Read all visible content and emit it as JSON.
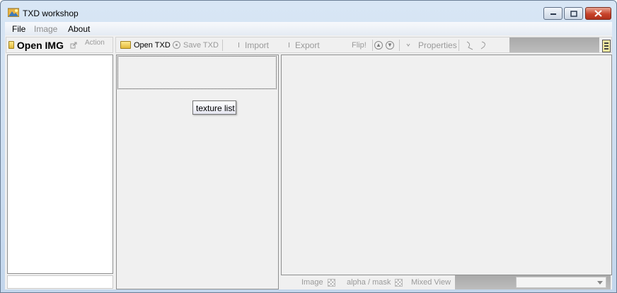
{
  "window": {
    "title": "TXD workshop",
    "controls": {
      "minimize": "▭",
      "maximize": "□",
      "close": "✕"
    }
  },
  "menu": {
    "file": "File",
    "image": "Image",
    "about": "About"
  },
  "img_toolbar": {
    "open_img": "Open IMG",
    "action": "Action"
  },
  "txd_toolbar": {
    "open_txd": "Open TXD",
    "save_txd": "Save TXD",
    "import": "Import",
    "export": "Export",
    "flip": "Flip!",
    "properties": "Properties"
  },
  "tooltip": {
    "text": "texture list"
  },
  "preview_bar": {
    "image": "Image",
    "alpha_mask": "alpha / mask",
    "mixed_view": "Mixed View"
  },
  "colors": {
    "titlebar": "#c9dbef",
    "client": "#f0f0f0",
    "close_button": "#c7432a",
    "toolbar_fill": "#b0b0b0"
  }
}
